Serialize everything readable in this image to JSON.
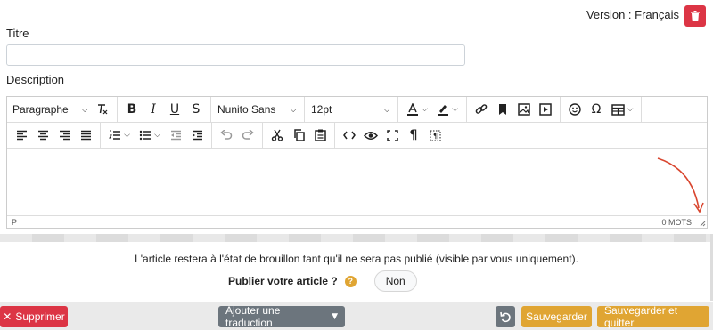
{
  "header": {
    "version_label": "Version : Français"
  },
  "form": {
    "title_label": "Titre",
    "title_value": "",
    "description_label": "Description"
  },
  "editor": {
    "block_format": "Paragraphe",
    "font_family": "Nunito Sans",
    "font_size": "12pt",
    "status_path": "P",
    "word_count": "0 MOTS",
    "toolbar_row1_icons": [
      "clear-format-icon",
      "bold-icon",
      "italic-icon",
      "underline-icon",
      "strikethrough-icon",
      "text-color-icon",
      "highlight-icon",
      "link-icon",
      "bookmark-icon",
      "image-icon",
      "media-icon",
      "emoji-icon",
      "special-char-icon",
      "table-icon"
    ],
    "toolbar_row2_icons": [
      "align-left-icon",
      "align-center-icon",
      "align-right-icon",
      "align-justify-icon",
      "numbered-list-icon",
      "bullet-list-icon",
      "outdent-icon",
      "indent-icon",
      "undo-icon",
      "redo-icon",
      "cut-icon",
      "copy-icon",
      "paste-icon",
      "code-icon",
      "preview-icon",
      "fullscreen-icon",
      "paragraph-marks-icon",
      "show-blocks-icon"
    ]
  },
  "publish": {
    "draft_note": "L'article restera à l'état de brouillon tant qu'il ne sera pas publié (visible par vous uniquement).",
    "question": "Publier votre article ?",
    "help_glyph": "?",
    "toggle_value": "Non"
  },
  "footer": {
    "delete_label": "Supprimer",
    "add_translation_label": "Ajouter une traduction",
    "save_label": "Sauvegarder",
    "save_quit_label": "Sauvegarder et quitter"
  },
  "colors": {
    "danger": "#dc3545",
    "warning": "#e0a533",
    "secondary": "#6c757d"
  }
}
